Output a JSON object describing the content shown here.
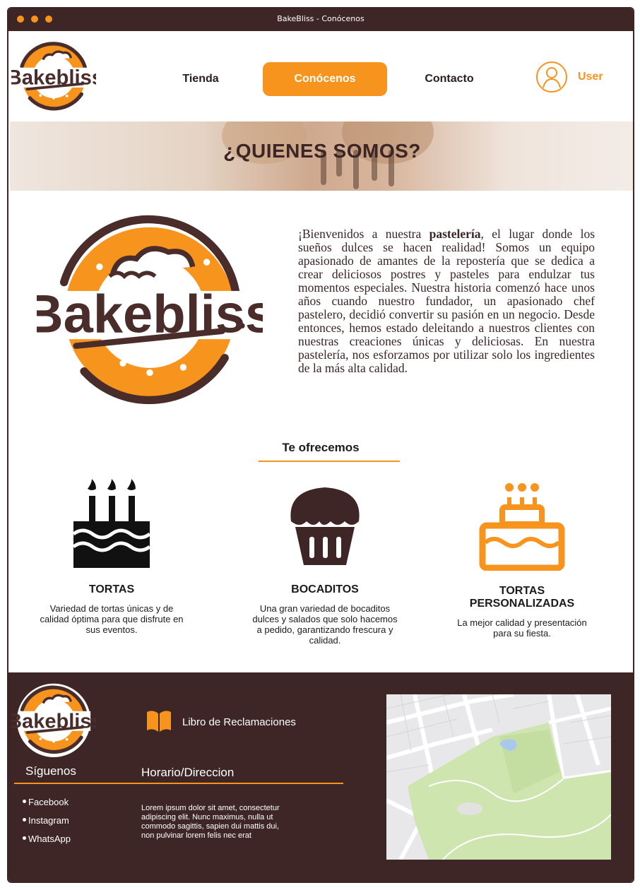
{
  "window": {
    "title": "BakeBliss - Conócenos"
  },
  "brand": {
    "name": "Bakebliss",
    "primary": "#f7941d",
    "dark": "#3f2626"
  },
  "nav": {
    "items": [
      {
        "label": "Tienda",
        "active": false
      },
      {
        "label": "Conócenos",
        "active": true
      },
      {
        "label": "Contacto",
        "active": false
      }
    ],
    "user_label": "User",
    "user_icon": "user-icon"
  },
  "hero": {
    "title": "¿QUIENES SOMOS?"
  },
  "intro": {
    "before": "¡Bienvenidos a nuestra ",
    "bold": "pastelería",
    "after": ", el lugar donde los sueños dulces se hacen realidad! Somos un equipo apasionado de amantes de la repostería que se dedica a crear deliciosos postres y pasteles para endulzar tus momentos especiales. Nuestra historia comenzó hace unos años cuando nuestro fundador, un apasionado chef pastelero, decidió convertir su pasión en un negocio. Desde entonces, hemos estado deleitando a nuestros clientes con nuestras creaciones únicas y deliciosas. En nuestra pastelería, nos esforzamos por utilizar solo los ingredientes de la más alta calidad."
  },
  "offer": {
    "title": "Te ofrecemos",
    "services": [
      {
        "name": "TORTAS",
        "icon": "birthday-cake-icon",
        "desc": "Variedad de tortas únicas y de calidad óptima para que disfrute en sus eventos."
      },
      {
        "name": "BOCADITOS",
        "icon": "cupcake-icon",
        "desc": "Una gran variedad de bocaditos dulces y salados que solo hacemos a pedido, garantizando frescura y calidad."
      },
      {
        "name": "TORTAS PERSONALIZADAS",
        "icon": "custom-cake-icon",
        "desc": "La mejor calidad y presentación para su fiesta."
      }
    ]
  },
  "footer": {
    "complaints": "Libro de Reclamaciones",
    "follow_title": "Síguenos",
    "schedule_title": "Horario/Direccion",
    "social": [
      "Facebook",
      "Instagram",
      "WhatsApp"
    ],
    "body": "Lorem ipsum dolor sit amet, consectetur adipiscing elit. Nunc maximus, nulla ut commodo sagittis, sapien dui mattis dui, non pulvinar lorem felis nec erat"
  }
}
